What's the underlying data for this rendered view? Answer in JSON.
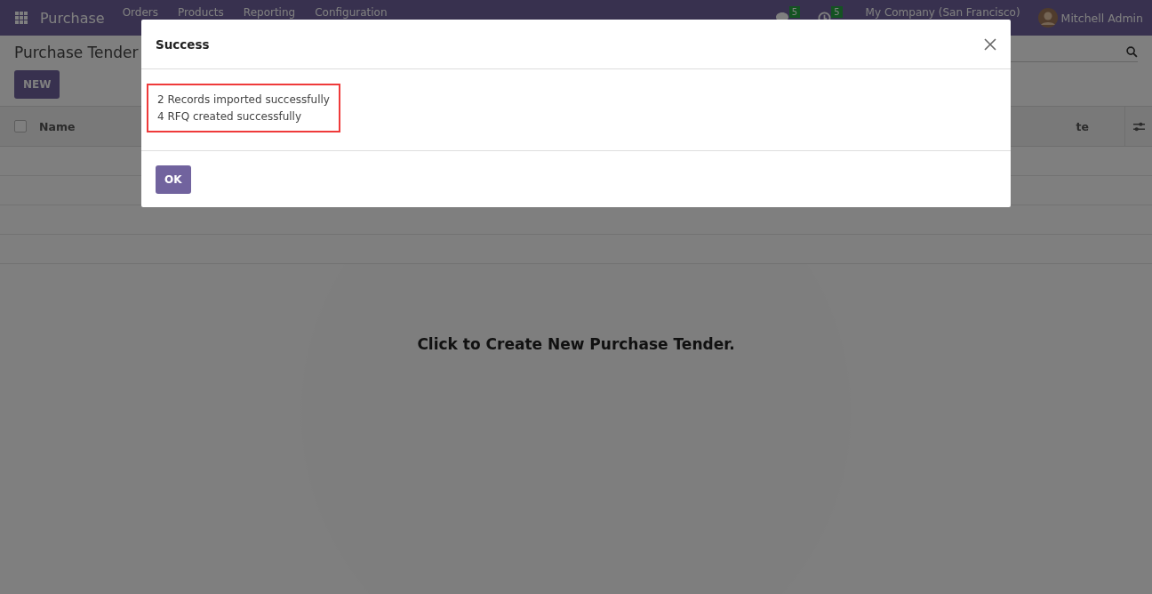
{
  "navbar": {
    "app_name": "Purchase",
    "menu": [
      "Orders",
      "Products",
      "Reporting",
      "Configuration"
    ],
    "messages_badge": "5",
    "activities_badge": "5",
    "company": "My Company (San Francisco)",
    "user": "Mitchell Admin"
  },
  "control_panel": {
    "title": "Purchase Tender",
    "new_button": "NEW"
  },
  "list": {
    "columns": [
      "Name",
      "te"
    ],
    "select_all": {
      "checked": false
    },
    "empty_help": "Click to Create New Purchase Tender."
  },
  "dialog": {
    "title": "Success",
    "messages": [
      "2 Records imported successfully",
      "4 RFQ created successfully"
    ],
    "highlighted": true,
    "ok_button": "OK"
  }
}
